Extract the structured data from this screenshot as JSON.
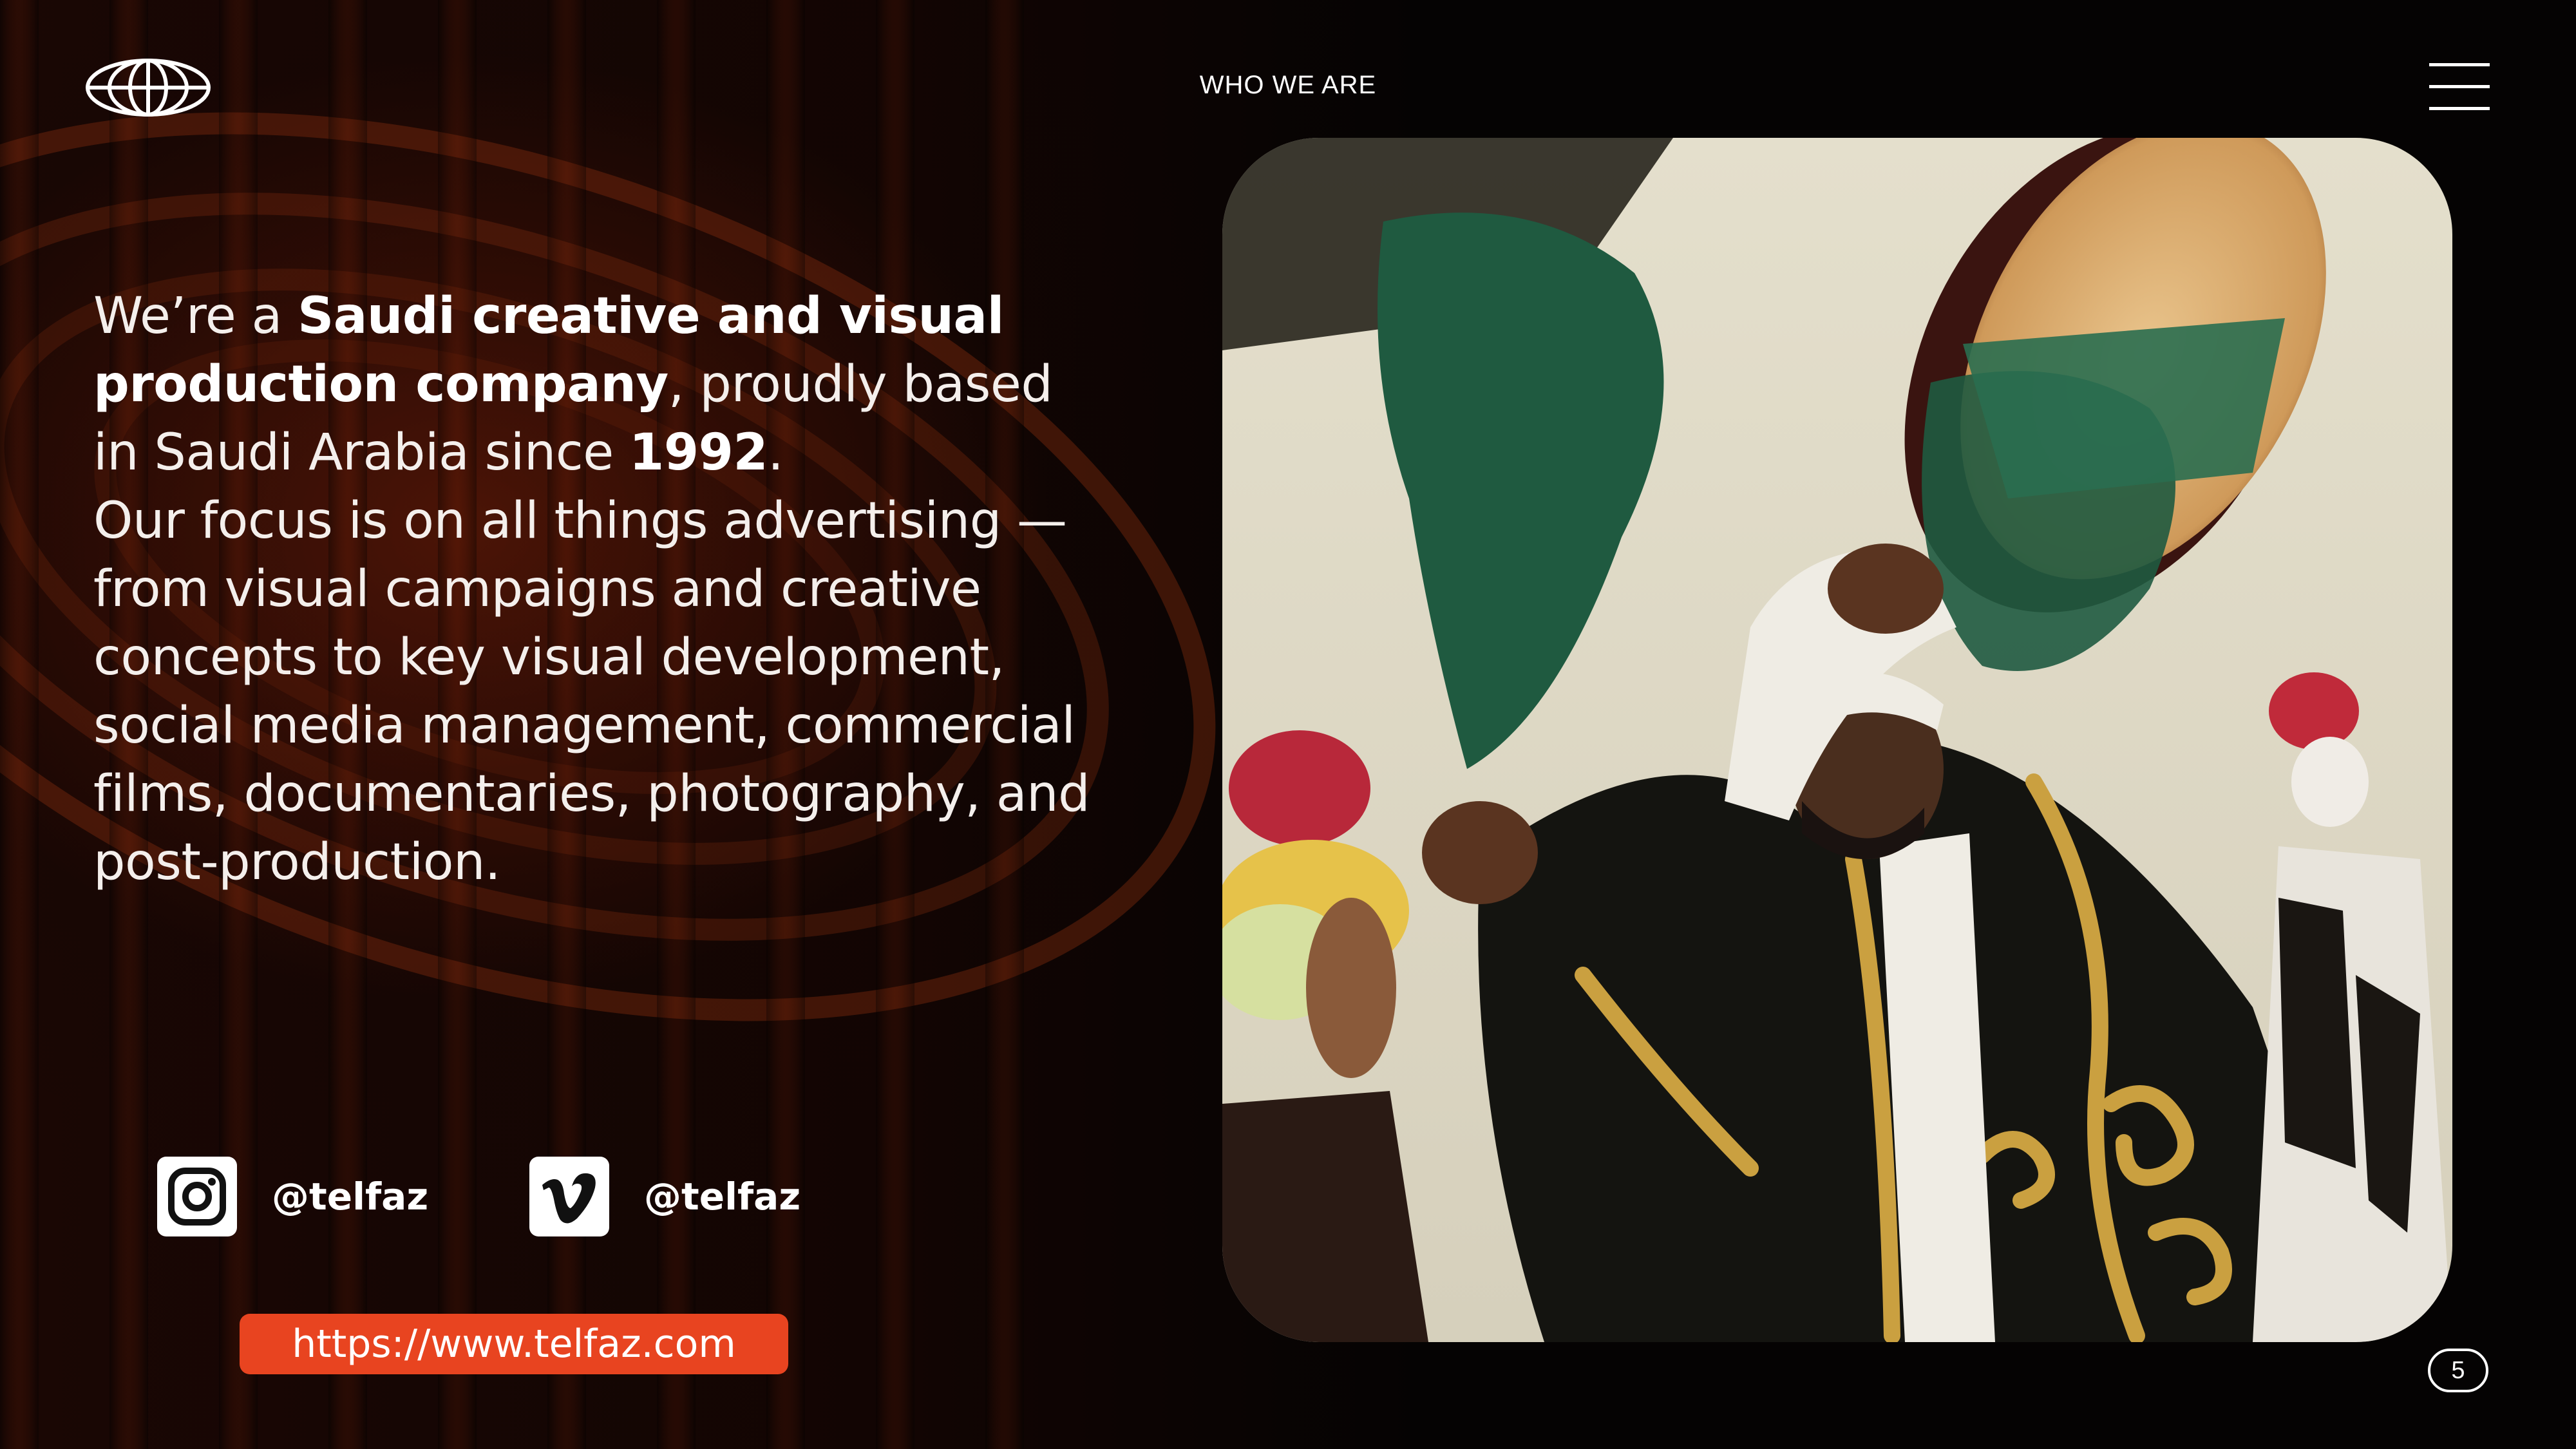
{
  "header": {
    "section_title": "WHO WE ARE"
  },
  "intro": {
    "p1_a": "We’re a ",
    "p1_b": "Saudi creative and visual production company",
    "p1_c": ", proudly based in Saudi Arabia since ",
    "p1_d": "1992",
    "p1_e": ".",
    "p2": "Our focus is on all things advertising — from visual campaigns and creative concepts to key visual development, social media management, commercial films, documentaries, photography, and post-production."
  },
  "social": {
    "instagram": {
      "icon": "instagram-icon",
      "handle": "@telfaz"
    },
    "vimeo": {
      "icon": "vimeo-icon",
      "handle": "@telfaz"
    }
  },
  "website": {
    "url": "https://www.telfaz.com"
  },
  "page": {
    "number": "5"
  },
  "colors": {
    "background": "#050303",
    "accent": "#e84420",
    "text": "#ffffff"
  }
}
